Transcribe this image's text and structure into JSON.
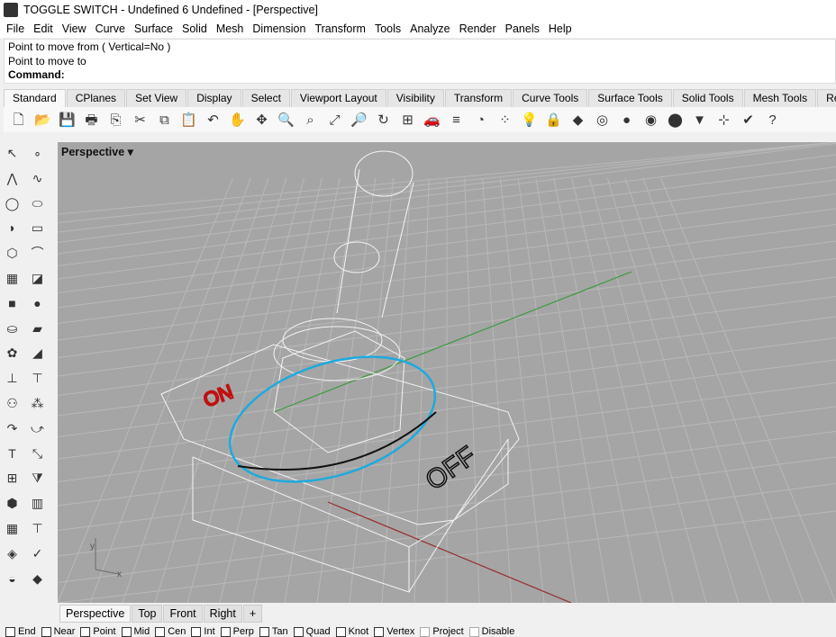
{
  "window": {
    "title": "TOGGLE SWITCH - Undefined 6 Undefined - [Perspective]"
  },
  "menu": [
    "File",
    "Edit",
    "View",
    "Curve",
    "Surface",
    "Solid",
    "Mesh",
    "Dimension",
    "Transform",
    "Tools",
    "Analyze",
    "Render",
    "Panels",
    "Help"
  ],
  "command": {
    "history": [
      "Point to move from ( Vertical=No )",
      "Point to move to"
    ],
    "prompt": "Command:"
  },
  "toolbar_tabs": [
    "Standard",
    "CPlanes",
    "Set View",
    "Display",
    "Select",
    "Viewport Layout",
    "Visibility",
    "Transform",
    "Curve Tools",
    "Surface Tools",
    "Solid Tools",
    "Mesh Tools",
    "Render"
  ],
  "toolbar_icons": [
    [
      "new-icon",
      "🗋"
    ],
    [
      "open-icon",
      "📂"
    ],
    [
      "save-icon",
      "💾"
    ],
    [
      "print-icon",
      "🖶"
    ],
    [
      "import-icon",
      "⎘"
    ],
    [
      "cut-icon",
      "✂"
    ],
    [
      "copy-icon",
      "⧉"
    ],
    [
      "paste-icon",
      "📋"
    ],
    [
      "undo-icon",
      "↶"
    ],
    [
      "pan-icon",
      "✋"
    ],
    [
      "rotate-view-icon",
      "✥"
    ],
    [
      "zoom-icon",
      "🔍"
    ],
    [
      "zoom-window-icon",
      "⌕"
    ],
    [
      "zoom-extents-icon",
      "⤢"
    ],
    [
      "zoom-selected-icon",
      "🔎"
    ],
    [
      "rotate-icon",
      "↻"
    ],
    [
      "four-views-icon",
      "⊞"
    ],
    [
      "car-icon",
      "🚗"
    ],
    [
      "layer-icon",
      "≡"
    ],
    [
      "snap-icon",
      "◔"
    ],
    [
      "point-icon",
      "⁘"
    ],
    [
      "light-icon",
      "💡"
    ],
    [
      "lock-icon",
      "🔒"
    ],
    [
      "material-icon",
      "◆"
    ],
    [
      "color-icon",
      "◎"
    ],
    [
      "shade-icon",
      "●"
    ],
    [
      "render-icon",
      "◉"
    ],
    [
      "sphere-icon",
      "⬤"
    ],
    [
      "filter-icon",
      "▼"
    ],
    [
      "gumball-icon",
      "⊹"
    ],
    [
      "check-icon",
      "✔"
    ],
    [
      "help-icon",
      "?"
    ]
  ],
  "left_icons": [
    [
      "select-icon",
      "↖"
    ],
    [
      "point-icon",
      "∘"
    ],
    [
      "polyline-icon",
      "⋀"
    ],
    [
      "curve-icon",
      "∿"
    ],
    [
      "circle-icon",
      "◯"
    ],
    [
      "ellipse-icon",
      "⬭"
    ],
    [
      "arc-icon",
      "◗"
    ],
    [
      "rectangle-icon",
      "▭"
    ],
    [
      "polygon-icon",
      "⬡"
    ],
    [
      "fillet-icon",
      "⌒"
    ],
    [
      "surface-icon",
      "▦"
    ],
    [
      "extrude-icon",
      "◪"
    ],
    [
      "box-icon",
      "■"
    ],
    [
      "sphere-icon",
      "●"
    ],
    [
      "cylinder-icon",
      "⛀"
    ],
    [
      "mesh-icon",
      "▰"
    ],
    [
      "boolean-icon",
      "✿"
    ],
    [
      "transform-icon",
      "◢"
    ],
    [
      "split-icon",
      "⊥"
    ],
    [
      "trim-icon",
      "⊤"
    ],
    [
      "group-icon",
      "⚇"
    ],
    [
      "points-icon",
      "⁂"
    ],
    [
      "bend-icon",
      "↷"
    ],
    [
      "offset-icon",
      "⤻"
    ],
    [
      "text-icon",
      "T"
    ],
    [
      "scale-icon",
      "⤡"
    ],
    [
      "array-icon",
      "⊞"
    ],
    [
      "mirror-icon",
      "⧩"
    ],
    [
      "solid-icon",
      "⬢"
    ],
    [
      "layout-icon",
      "▥"
    ],
    [
      "grid-icon",
      "▦"
    ],
    [
      "dim-icon",
      "⊤"
    ],
    [
      "analyze-icon",
      "◈"
    ],
    [
      "check-icon",
      "✓"
    ],
    [
      "render-icon",
      "◒"
    ],
    [
      "paint-icon",
      "◆"
    ]
  ],
  "viewport": {
    "label": "Perspective",
    "axis_x": "x",
    "axis_y": "y",
    "off_text": "OFF",
    "on_text": "ON"
  },
  "viewport_tabs": [
    "Perspective",
    "Top",
    "Front",
    "Right",
    "+"
  ],
  "osnaps": [
    {
      "label": "End",
      "enabled": true
    },
    {
      "label": "Near",
      "enabled": true
    },
    {
      "label": "Point",
      "enabled": true
    },
    {
      "label": "Mid",
      "enabled": true
    },
    {
      "label": "Cen",
      "enabled": true
    },
    {
      "label": "Int",
      "enabled": true
    },
    {
      "label": "Perp",
      "enabled": true
    },
    {
      "label": "Tan",
      "enabled": true
    },
    {
      "label": "Quad",
      "enabled": true
    },
    {
      "label": "Knot",
      "enabled": true
    },
    {
      "label": "Vertex",
      "enabled": true
    },
    {
      "label": "Project",
      "enabled": false
    },
    {
      "label": "Disable",
      "enabled": false
    }
  ]
}
